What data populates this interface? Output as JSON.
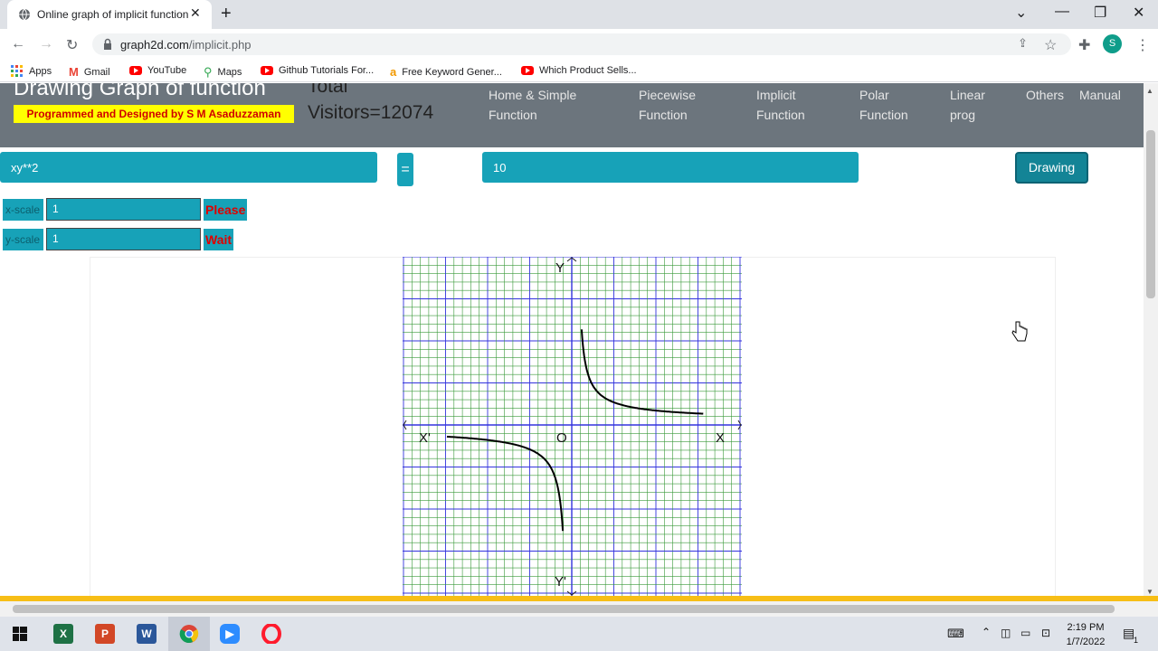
{
  "browser": {
    "tab_title": "Online graph of implicit function",
    "new_tab": "+",
    "close_tab": "✕",
    "url_domain": "graph2d.com",
    "url_path": "/implicit.php",
    "profile_initial": "S",
    "bookmarks": [
      "Apps",
      "Gmail",
      "YouTube",
      "Maps",
      "Github Tutorials For...",
      "Free Keyword Gener...",
      "Which Product Sells..."
    ]
  },
  "site": {
    "title": "Drawing Graph of function",
    "credit": "Programmed and Designed by S M Asaduzzaman",
    "visitors_label": "Total",
    "visitors_count": "Visitors=12074",
    "nav": [
      {
        "line1": "Home & Simple",
        "line2": "Function"
      },
      {
        "line1": "Piecewise",
        "line2": "Function"
      },
      {
        "line1": "Implicit",
        "line2": "Function"
      },
      {
        "line1": "Polar",
        "line2": "Function"
      },
      {
        "line1": "Linear",
        "line2": "prog"
      },
      {
        "line1": "Others",
        "line2": ""
      },
      {
        "line1": "Manual",
        "line2": ""
      }
    ]
  },
  "form": {
    "lhs_value": "xy**2",
    "equals": "=",
    "rhs_value": "10",
    "draw_button": "Drawing",
    "xscale_label": "x-scale",
    "xscale_value": "1",
    "yscale_label": "y-scale",
    "yscale_value": "1",
    "status_line1": "Please",
    "status_line2": "Wait"
  },
  "graph": {
    "label_y_top": "Y",
    "label_y_bottom": "Y'",
    "label_x_right": "X",
    "label_x_left": "X'",
    "label_origin": "O",
    "minor_grid_color": "#3a9a3a",
    "major_grid_color": "#3333dd"
  },
  "taskbar": {
    "time": "2:19 PM",
    "date": "1/7/2022",
    "notification_count": "1"
  }
}
